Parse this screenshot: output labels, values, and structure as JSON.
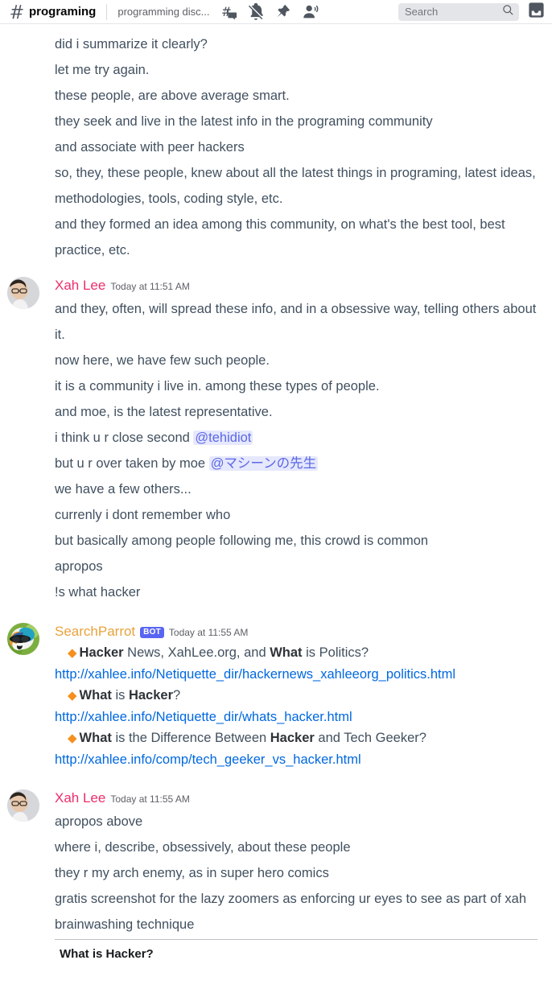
{
  "topbar": {
    "hash_icon": "hash-icon",
    "channel_name": "programing",
    "channel_topic": "programming disc...",
    "icons": [
      {
        "name": "threads-icon"
      },
      {
        "name": "notification-muted-icon"
      },
      {
        "name": "pinned-messages-icon"
      },
      {
        "name": "member-list-icon"
      }
    ],
    "search_placeholder": "Search",
    "search_value": "",
    "search_icon": "search-icon",
    "inbox_icon": "inbox-icon"
  },
  "colors": {
    "author_xah": "#ed2e6a",
    "author_bot": "#e8a33d",
    "link": "#0068e0",
    "mention_text": "#5b68e6",
    "mention_bg": "rgba(88,101,242,0.15)",
    "bot_badge_bg": "#5865f2",
    "diamond": "#f5901e",
    "body_text": "#41505f"
  },
  "messages": [
    {
      "id": "msg-continuation-top",
      "has_header": false,
      "lines": [
        "did i summarize it clearly?",
        "let me try again.",
        "these people, are above average smart.",
        "they seek and live in the latest info in the programing community",
        "and associate with peer hackers",
        "so, they, these people, knew about all the latest things in programing, latest ideas, methodologies, tools, coding style, etc.",
        "and they formed an idea among this community, on what's the best tool, best practice, etc."
      ]
    },
    {
      "id": "msg-xah-1151",
      "has_header": true,
      "author": "Xah Lee",
      "author_color": "#ed2e6a",
      "timestamp": "Today at 11:51 AM",
      "avatar_name": "avatar-xah-lee",
      "lines": [
        "and they, often, will spread these info, and in a obsessive way, telling others about it.",
        "now here, we have few such people.",
        "it is a community i live in. among these types of people.",
        "and moe, is the latest representative."
      ],
      "mention_lines": [
        {
          "prefix": "i think u r close second ",
          "mention": "@tehidiot",
          "suffix": ""
        },
        {
          "prefix": "but u r over taken by moe ",
          "mention": "@マシーンの先生",
          "suffix": ""
        }
      ],
      "tail_lines": [
        "we have a few others...",
        "currenly i dont remember who",
        "but basically among people following me, this crowd is common",
        "apropos",
        "!s what hacker"
      ]
    },
    {
      "id": "msg-searchparrot-1155",
      "has_header": true,
      "author": "SearchParrot",
      "author_color": "#e8a33d",
      "bot_badge": "BOT",
      "timestamp": "Today at 11:55 AM",
      "avatar_name": "avatar-searchparrot",
      "results": [
        {
          "diamond": "◆",
          "title_parts": [
            {
              "t": "Hacker",
              "bold": true
            },
            {
              "t": " News, XahLee.org, and ",
              "bold": false
            },
            {
              "t": "What",
              "bold": true
            },
            {
              "t": " is Politics?",
              "bold": false
            }
          ],
          "url": "http://xahlee.info/Netiquette_dir/hackernews_xahleeorg_politics.html"
        },
        {
          "diamond": "◆",
          "title_parts": [
            {
              "t": "What",
              "bold": true
            },
            {
              "t": " is ",
              "bold": false
            },
            {
              "t": "Hacker",
              "bold": true
            },
            {
              "t": "?",
              "bold": false
            }
          ],
          "url": "http://xahlee.info/Netiquette_dir/whats_hacker.html"
        },
        {
          "diamond": "◆",
          "title_parts": [
            {
              "t": "What",
              "bold": true
            },
            {
              "t": " is the Difference Between ",
              "bold": false
            },
            {
              "t": "Hacker",
              "bold": true
            },
            {
              "t": " and Tech Geeker?",
              "bold": false
            }
          ],
          "url": "http://xahlee.info/comp/tech_geeker_vs_hacker.html"
        }
      ]
    },
    {
      "id": "msg-xah-1155",
      "has_header": true,
      "author": "Xah Lee",
      "author_color": "#ed2e6a",
      "timestamp": "Today at 11:55 AM",
      "avatar_name": "avatar-xah-lee",
      "lines": [
        "apropos above",
        "where i, describe, obsessively, about these people",
        "they r my arch enemy, as in super hero comics",
        "gratis screenshot for the lazy zoomers as enforcing ur eyes to see as part of xah brainwashing technique"
      ],
      "attachment": {
        "name": "embedded-webpage-screenshot",
        "title": "What is Hacker?"
      }
    }
  ]
}
